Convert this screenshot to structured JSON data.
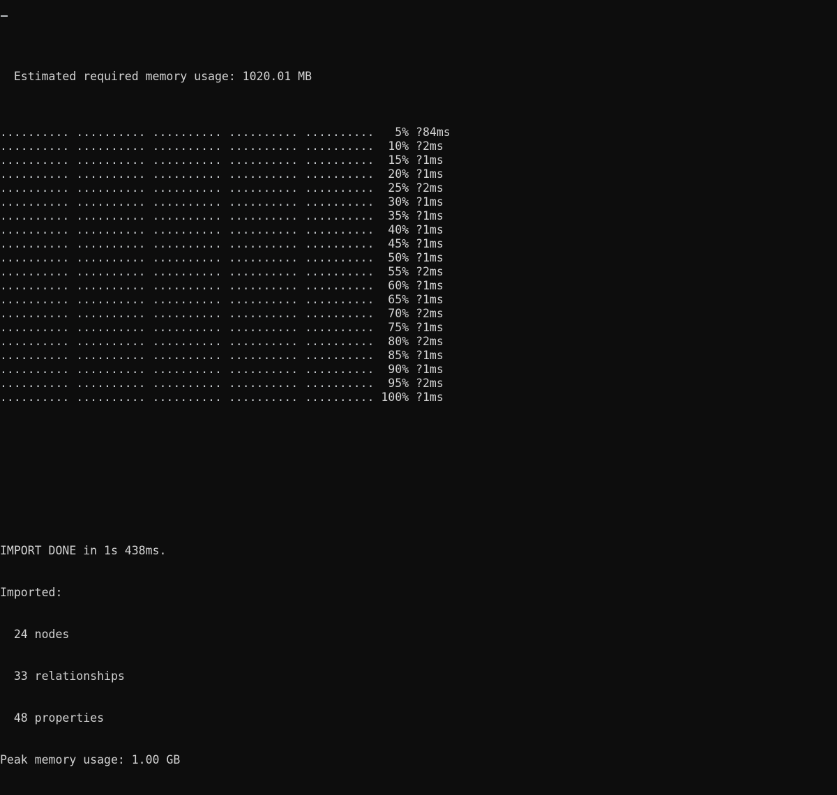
{
  "terminal": {
    "background_color": "#0d0d0d",
    "foreground_color": "#d4d4d4",
    "header_line": "  Estimated required memory usage: 1020.01 MB",
    "dots_segment": "..........",
    "dots_group_count": 5,
    "dots_separator": " ",
    "unknown_glyph": "?",
    "progress_rows": [
      {
        "dots": ".......... .......... .......... .......... ..........",
        "percent": "  5%",
        "elapsed": "?84ms"
      },
      {
        "dots": ".......... .......... .......... .......... ..........",
        "percent": " 10%",
        "elapsed": "?2ms"
      },
      {
        "dots": ".......... .......... .......... .......... ..........",
        "percent": " 15%",
        "elapsed": "?1ms"
      },
      {
        "dots": ".......... .......... .......... .......... ..........",
        "percent": " 20%",
        "elapsed": "?1ms"
      },
      {
        "dots": ".......... .......... .......... .......... ..........",
        "percent": " 25%",
        "elapsed": "?2ms"
      },
      {
        "dots": ".......... .......... .......... .......... ..........",
        "percent": " 30%",
        "elapsed": "?1ms"
      },
      {
        "dots": ".......... .......... .......... .......... ..........",
        "percent": " 35%",
        "elapsed": "?1ms"
      },
      {
        "dots": ".......... .......... .......... .......... ..........",
        "percent": " 40%",
        "elapsed": "?1ms"
      },
      {
        "dots": ".......... .......... .......... .......... ..........",
        "percent": " 45%",
        "elapsed": "?1ms"
      },
      {
        "dots": ".......... .......... .......... .......... ..........",
        "percent": " 50%",
        "elapsed": "?1ms"
      },
      {
        "dots": ".......... .......... .......... .......... ..........",
        "percent": " 55%",
        "elapsed": "?2ms"
      },
      {
        "dots": ".......... .......... .......... .......... ..........",
        "percent": " 60%",
        "elapsed": "?1ms"
      },
      {
        "dots": ".......... .......... .......... .......... ..........",
        "percent": " 65%",
        "elapsed": "?1ms"
      },
      {
        "dots": ".......... .......... .......... .......... ..........",
        "percent": " 70%",
        "elapsed": "?2ms"
      },
      {
        "dots": ".......... .......... .......... .......... ..........",
        "percent": " 75%",
        "elapsed": "?1ms"
      },
      {
        "dots": ".......... .......... .......... .......... ..........",
        "percent": " 80%",
        "elapsed": "?2ms"
      },
      {
        "dots": ".......... .......... .......... .......... ..........",
        "percent": " 85%",
        "elapsed": "?1ms"
      },
      {
        "dots": ".......... .......... .......... .......... ..........",
        "percent": " 90%",
        "elapsed": "?1ms"
      },
      {
        "dots": ".......... .......... .......... .......... ..........",
        "percent": " 95%",
        "elapsed": "?2ms"
      },
      {
        "dots": ".......... .......... .......... .......... ..........",
        "percent": "100%",
        "elapsed": "?1ms"
      }
    ],
    "summary": {
      "done_line": "IMPORT DONE in 1s 438ms.",
      "imported_label": "Imported:",
      "nodes_line": "  24 nodes",
      "relationships_line": "  33 relationships",
      "properties_line": "  48 properties",
      "peak_memory_line": "Peak memory usage: 1.00 GB"
    },
    "stats": {
      "estimated_memory_mb": "1020.01",
      "estimated_memory_unit": "MB",
      "duration": "1s 438ms",
      "nodes": "24",
      "relationships": "33",
      "properties": "48",
      "peak_memory": "1.00",
      "peak_memory_unit": "GB"
    }
  }
}
